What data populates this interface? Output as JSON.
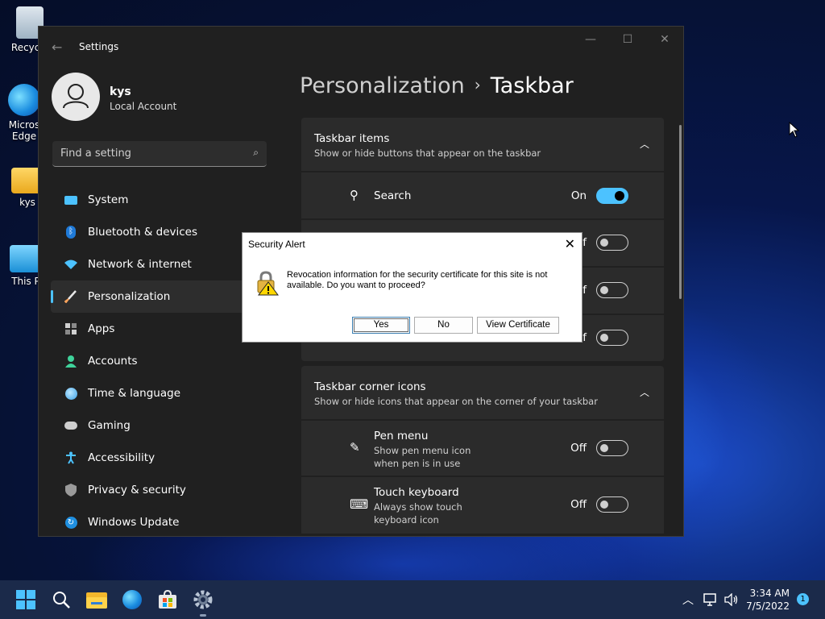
{
  "desktop": {
    "icons": [
      {
        "label": "Recycle",
        "icon": "recycle-bin-icon"
      },
      {
        "label": "Micros\nEdge",
        "icon": "edge-icon"
      },
      {
        "label": "kys",
        "icon": "folder-icon"
      },
      {
        "label": "This P",
        "icon": "monitor-icon"
      }
    ]
  },
  "window": {
    "title": "Settings",
    "user": {
      "name": "kys",
      "account_type": "Local Account"
    },
    "search": {
      "placeholder": "Find a setting"
    },
    "nav": [
      {
        "label": "System",
        "icon": "system-icon",
        "color": "#4cc2ff"
      },
      {
        "label": "Bluetooth & devices",
        "icon": "bluetooth-icon",
        "color": "#4cc2ff"
      },
      {
        "label": "Network & internet",
        "icon": "wifi-icon",
        "color": "#4cc2ff"
      },
      {
        "label": "Personalization",
        "icon": "brush-icon",
        "color": "#f7a35c",
        "active": true
      },
      {
        "label": "Apps",
        "icon": "apps-icon",
        "color": "#cfcfcf"
      },
      {
        "label": "Accounts",
        "icon": "person-icon",
        "color": "#3fd39b"
      },
      {
        "label": "Time & language",
        "icon": "globe-icon",
        "color": "#4cc2ff"
      },
      {
        "label": "Gaming",
        "icon": "gamepad-icon",
        "color": "#cfcfcf"
      },
      {
        "label": "Accessibility",
        "icon": "accessibility-icon",
        "color": "#4cc2ff"
      },
      {
        "label": "Privacy & security",
        "icon": "shield-icon",
        "color": "#cfcfcf"
      },
      {
        "label": "Windows Update",
        "icon": "update-icon",
        "color": "#4cc2ff"
      }
    ],
    "breadcrumb": {
      "parent": "Personalization",
      "separator": "›",
      "current": "Taskbar"
    },
    "sections": {
      "taskbar_items": {
        "title": "Taskbar items",
        "subtitle": "Show or hide buttons that appear on the taskbar",
        "rows": [
          {
            "title": "Search",
            "state": "On",
            "on": true
          },
          {
            "state": "f",
            "on": false
          },
          {
            "state": "f",
            "on": false
          },
          {
            "state": "f",
            "on": false
          }
        ]
      },
      "corner_icons": {
        "title": "Taskbar corner icons",
        "subtitle": "Show or hide icons that appear on the corner of your taskbar",
        "rows": [
          {
            "title": "Pen menu",
            "subtitle": "Show pen menu icon when pen is in use",
            "state": "Off",
            "on": false
          },
          {
            "title": "Touch keyboard",
            "subtitle": "Always show touch keyboard icon",
            "state": "Off",
            "on": false
          }
        ]
      }
    }
  },
  "dialog": {
    "title": "Security Alert",
    "message": "Revocation information for the security certificate for this site is not available. Do you want to proceed?",
    "buttons": {
      "yes": "Yes",
      "no": "No",
      "view": "View Certificate"
    }
  },
  "taskbar": {
    "time": "3:34 AM",
    "date": "7/5/2022",
    "notification_count": "1",
    "apps": [
      "start-icon",
      "search-icon",
      "file-explorer-icon",
      "edge-icon",
      "store-icon",
      "settings-icon"
    ]
  },
  "colors": {
    "accent": "#4cc2ff",
    "window_bg": "#202020",
    "card_bg": "#2b2b2b"
  }
}
